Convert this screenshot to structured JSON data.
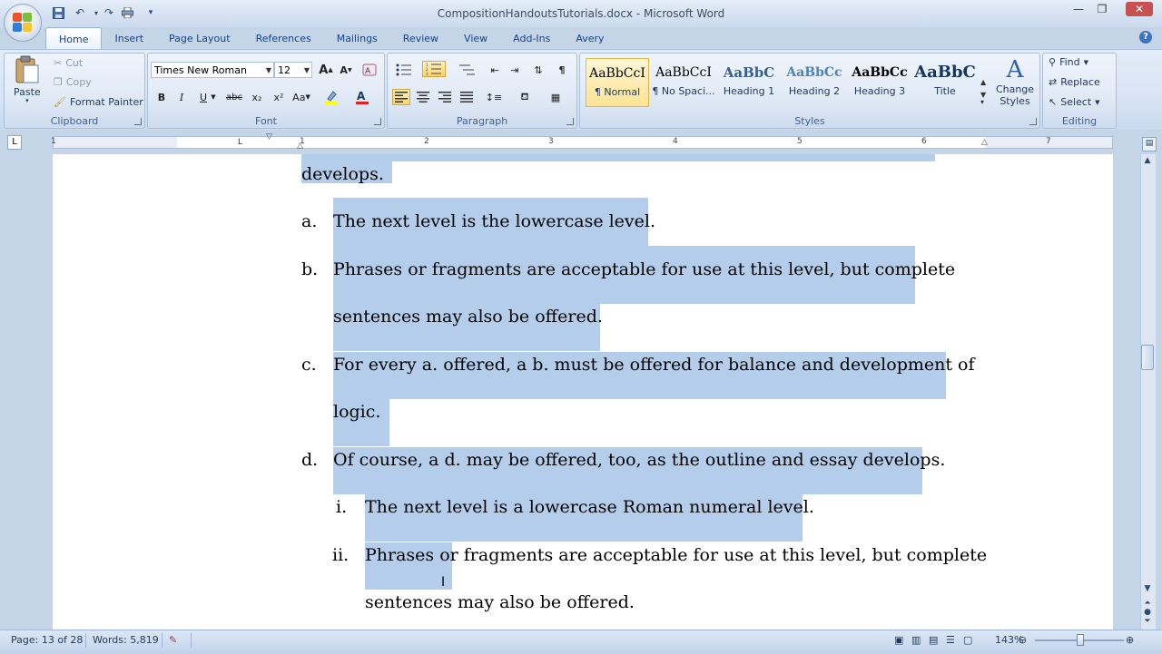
{
  "window": {
    "title": "CompositionHandoutsTutorials.docx - Microsoft Word"
  },
  "tabs": [
    "Home",
    "Insert",
    "Page Layout",
    "References",
    "Mailings",
    "Review",
    "View",
    "Add-Ins",
    "Avery"
  ],
  "clipboard": {
    "paste": "Paste",
    "cut": "Cut",
    "copy": "Copy",
    "format_painter": "Format Painter",
    "label": "Clipboard"
  },
  "font": {
    "family": "Times New Roman",
    "size": "12",
    "label": "Font",
    "bold": "B",
    "italic": "I",
    "underline": "U",
    "strike": "abc",
    "subscript": "x₂",
    "superscript": "x²",
    "change_case": "Aa",
    "grow": "A",
    "shrink": "A"
  },
  "paragraph": {
    "label": "Paragraph"
  },
  "styles": {
    "label": "Styles",
    "items": [
      {
        "sample": "AaBbCcI",
        "name": "¶ Normal"
      },
      {
        "sample": "AaBbCcI",
        "name": "¶ No Spaci..."
      },
      {
        "sample": "AaBbC",
        "name": "Heading 1"
      },
      {
        "sample": "AaBbCc",
        "name": "Heading 2"
      },
      {
        "sample": "AaBbCc",
        "name": "Heading 3"
      },
      {
        "sample": "AaBbC",
        "name": "Title"
      }
    ],
    "change_styles": "Change Styles"
  },
  "editing": {
    "label": "Editing",
    "find": "Find",
    "replace": "Replace",
    "select": "Select"
  },
  "ruler": {
    "numbers": [
      "1",
      "1",
      "2",
      "3",
      "4",
      "5",
      "6",
      "7"
    ]
  },
  "document": {
    "lines": [
      {
        "marker": "",
        "text": "develops."
      },
      {
        "marker": "a.",
        "text": "The next level is the lowercase level."
      },
      {
        "marker": "b.",
        "text": "Phrases or fragments are acceptable for use at this level, but complete"
      },
      {
        "marker": "",
        "text": "sentences may also be offered."
      },
      {
        "marker": "c.",
        "text": "For every a. offered, a b. must be offered for balance and development of"
      },
      {
        "marker": "",
        "text": "logic."
      },
      {
        "marker": "d.",
        "text": "Of course, a d. may be offered, too, as the outline and essay develops."
      },
      {
        "marker": "i.",
        "text": "The next level is a lowercase Roman numeral level."
      },
      {
        "marker": "ii.",
        "text": "Phrases or fragments are acceptable for use at this level, but complete"
      },
      {
        "marker": "",
        "text": "sentences may also be offered."
      }
    ]
  },
  "status": {
    "page": "Page: 13 of 28",
    "words": "Words: 5,819",
    "zoom": "143%"
  },
  "colors": {
    "selection": "#b3cdea",
    "ribbon": "#dbe6f4",
    "accent": "#15428b"
  }
}
